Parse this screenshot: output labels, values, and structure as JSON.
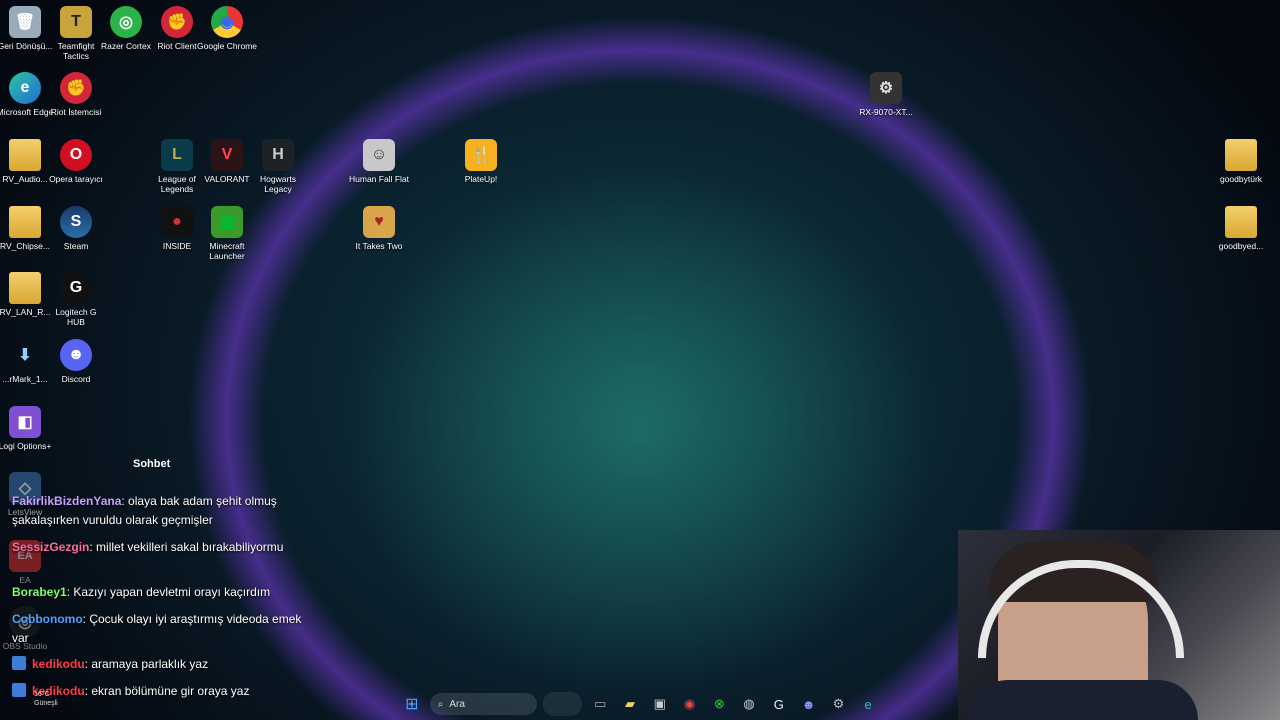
{
  "desktop": {
    "icons": [
      {
        "label": "Geri Dönüşü...",
        "icon": "recycle-bin-icon",
        "glyph": "🗑"
      },
      {
        "label": "Teamfight Tactics",
        "icon": "teamfight-tactics-icon",
        "glyph": "T"
      },
      {
        "label": "Razer Cortex",
        "icon": "razer-cortex-icon",
        "glyph": "◎"
      },
      {
        "label": "Riot Client",
        "icon": "riot-client-icon",
        "glyph": "✊"
      },
      {
        "label": "Google Chrome",
        "icon": "chrome-icon",
        "glyph": "◉"
      },
      {
        "label": "Microsoft Edge",
        "icon": "edge-icon",
        "glyph": "e"
      },
      {
        "label": "Riot İstemcisi",
        "icon": "riot-istemcisi-icon",
        "glyph": "✊"
      },
      {
        "label": "RV_Audio...",
        "icon": "folder-icon",
        "glyph": ""
      },
      {
        "label": "Opera tarayıcı",
        "icon": "opera-icon",
        "glyph": "O"
      },
      {
        "label": "League of Legends",
        "icon": "league-of-legends-icon",
        "glyph": "L"
      },
      {
        "label": "VALORANT",
        "icon": "valorant-icon",
        "glyph": "V"
      },
      {
        "label": "Hogwarts Legacy",
        "icon": "hogwarts-legacy-icon",
        "glyph": "H"
      },
      {
        "label": "Human Fall Flat",
        "icon": "human-fall-flat-icon",
        "glyph": "☺"
      },
      {
        "label": "PlateUp!",
        "icon": "plateup-icon",
        "glyph": "🍴"
      },
      {
        "label": "RX-9070-XT...",
        "icon": "rx-driver-icon",
        "glyph": "⚙"
      },
      {
        "label": "goodbytürk",
        "icon": "folder-icon",
        "glyph": ""
      },
      {
        "label": "RV_Chipse...",
        "icon": "folder-icon",
        "glyph": ""
      },
      {
        "label": "Steam",
        "icon": "steam-icon",
        "glyph": "S"
      },
      {
        "label": "INSIDE",
        "icon": "inside-icon",
        "glyph": "●"
      },
      {
        "label": "Minecraft Launcher",
        "icon": "minecraft-icon",
        "glyph": "▦"
      },
      {
        "label": "It Takes Two",
        "icon": "it-takes-two-icon",
        "glyph": "♥"
      },
      {
        "label": "goodbyed...",
        "icon": "folder-icon",
        "glyph": ""
      },
      {
        "label": "RV_LAN_R...",
        "icon": "folder-icon",
        "glyph": ""
      },
      {
        "label": "Logitech G HUB",
        "icon": "logitech-ghub-icon",
        "glyph": "G"
      },
      {
        "label": "...rMark_1...",
        "icon": "download-icon",
        "glyph": "⬇"
      },
      {
        "label": "Discord",
        "icon": "discord-icon",
        "glyph": "☻"
      },
      {
        "label": "Logi Options+",
        "icon": "logi-options-icon",
        "glyph": "◧"
      },
      {
        "label": "LetsView",
        "icon": "letsview-icon",
        "glyph": "◇"
      },
      {
        "label": "EA",
        "icon": "ea-icon",
        "glyph": "EA"
      },
      {
        "label": "OBS Studio",
        "icon": "obs-icon",
        "glyph": "◎"
      }
    ]
  },
  "chat": {
    "title": "Sohbet",
    "messages": [
      {
        "user": "FakirlikBizdenYana",
        "color": "#c9a0ff",
        "text": ": olaya bak adam şehit olmuş şakalaşırken vuruldu olarak geçmişler"
      },
      {
        "user": "SessizGezgin",
        "color": "#ff6fa0",
        "text": ": millet vekilleri sakal bırakabiliyormu"
      },
      {
        "user": "Borabey1",
        "color": "#7dff6a",
        "text": ": Kazıyı yapan devletmi orayı kaçırdım"
      },
      {
        "user": "Cobbonomo",
        "color": "#4aa3ff",
        "text": ": Çocuk olayı iyi araştırmış videoda emek var"
      },
      {
        "user": "kedikodu",
        "color": "#ff3b4a",
        "text": ": aramaya parlaklık yaz"
      },
      {
        "user": "kedikodu",
        "color": "#ff3b4a",
        "text": ": ekran bölümüne gir oraya yaz"
      }
    ]
  },
  "weather": {
    "temp": "16°C",
    "label": "Güneşli"
  },
  "taskbar": {
    "search_placeholder": "Ara",
    "apps": [
      "start-icon",
      "file-explorer-icon",
      "folder-icon",
      "store-icon",
      "chrome-icon",
      "xbox-icon",
      "razer-icon",
      "logitech-icon",
      "discord-icon",
      "settings-icon",
      "edge-icon"
    ]
  }
}
